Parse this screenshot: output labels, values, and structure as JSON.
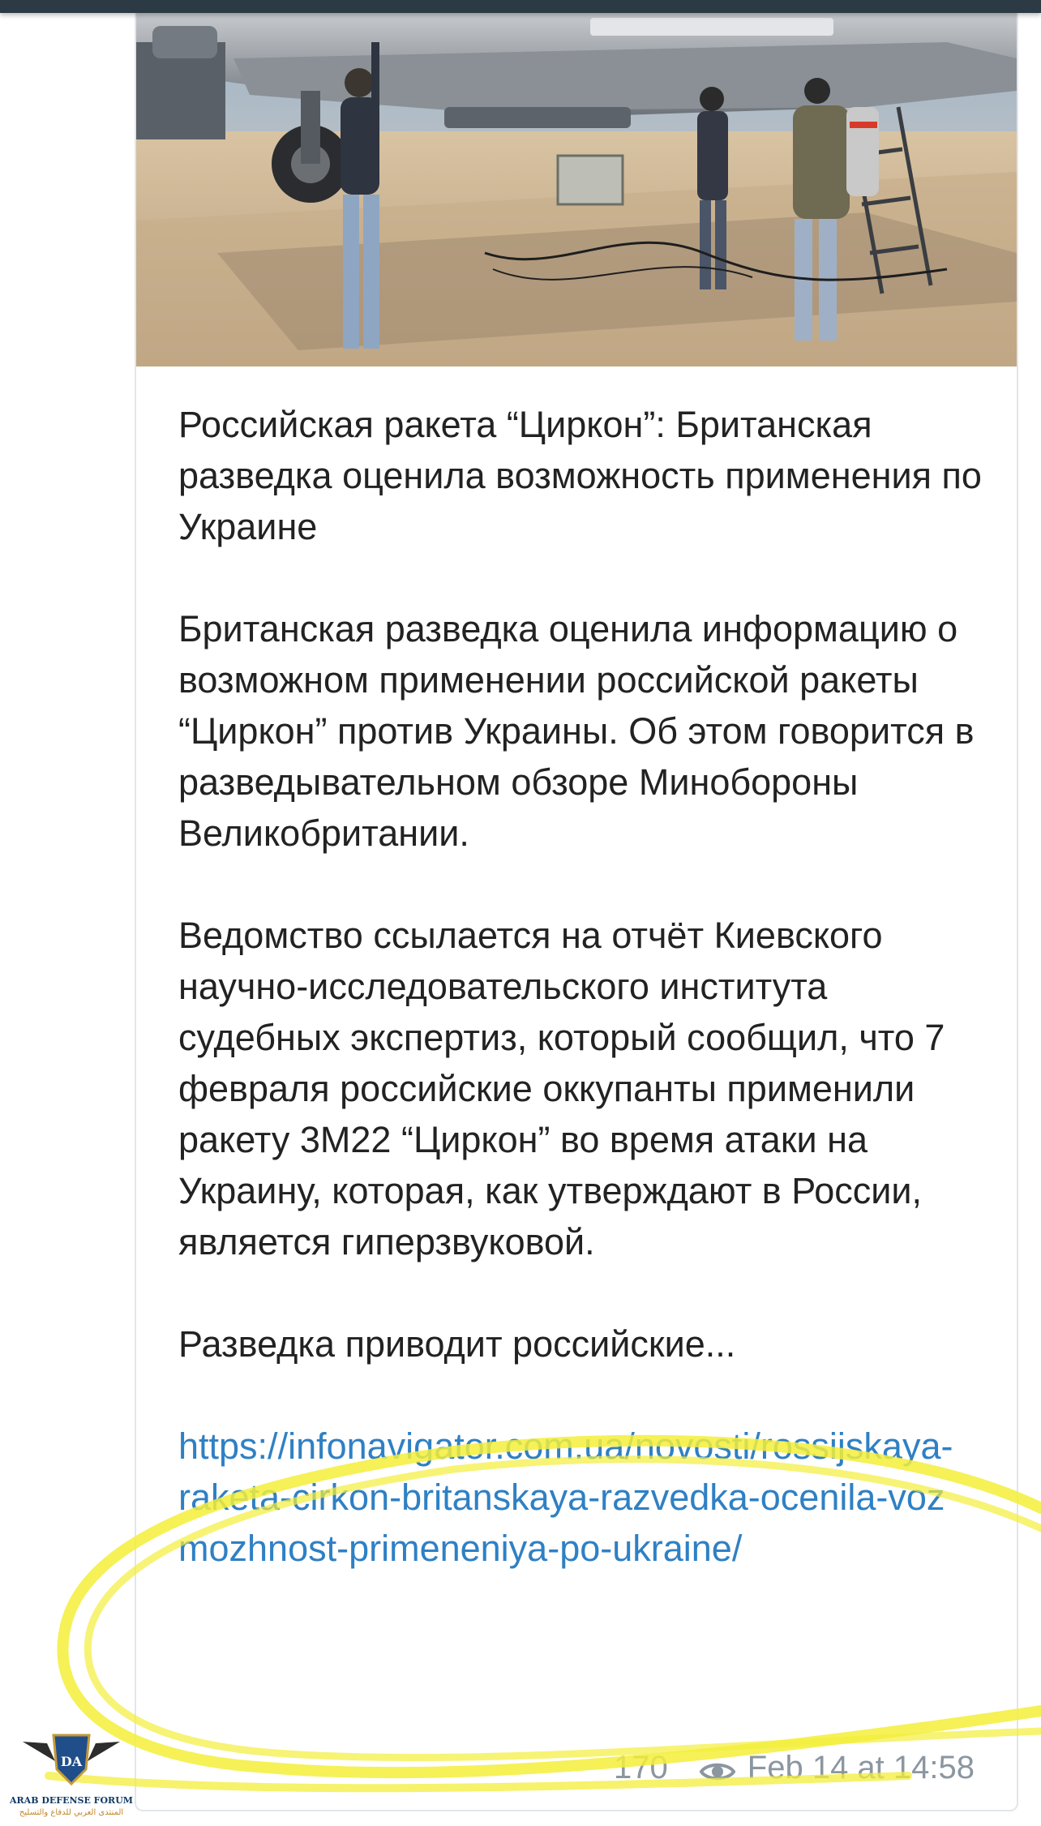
{
  "post": {
    "image_alt": "Technicians working under an aircraft on a tarmac",
    "headline": "Российская ракета “Циркон”: Британская разведка оценила возможность применения по Украине",
    "paragraph_1": "Британская разведка оценила информацию о возможном применении российской ракеты “Циркон” против Украины. Об этом говорится в разведывательном обзоре Минобороны Великобритании.",
    "paragraph_2": "Ведомство ссылается на отчёт Киевского научно-исследовательского института судебных экспертиз, который сообщил, что 7 февраля российские оккупанты применили ракету 3М22 “Циркон” во время атаки на Украину, которая, как утверждают в России, является гиперзвуковой.",
    "paragraph_3": "Разведка приводит российские...",
    "link": "https://infonavigator.com.ua/novosti/rossijskaya-raketa-cirkon-britanskaya-razvedka-ocenila-vozmozhnost-primeneniya-po-ukraine/",
    "views": "170",
    "date": "Feb 14 at 14:58"
  },
  "icons": {
    "views": "eye-icon"
  },
  "watermark": {
    "line1": "ARAB DEFENSE FORUM",
    "line2": "المنتدى العربي للدفاع والتسليح",
    "monogram": "DA"
  },
  "colors": {
    "link": "#2f80c4",
    "meta": "#8b96a0",
    "highlight": "#f3ee3a",
    "topbar": "#2b3a44"
  }
}
